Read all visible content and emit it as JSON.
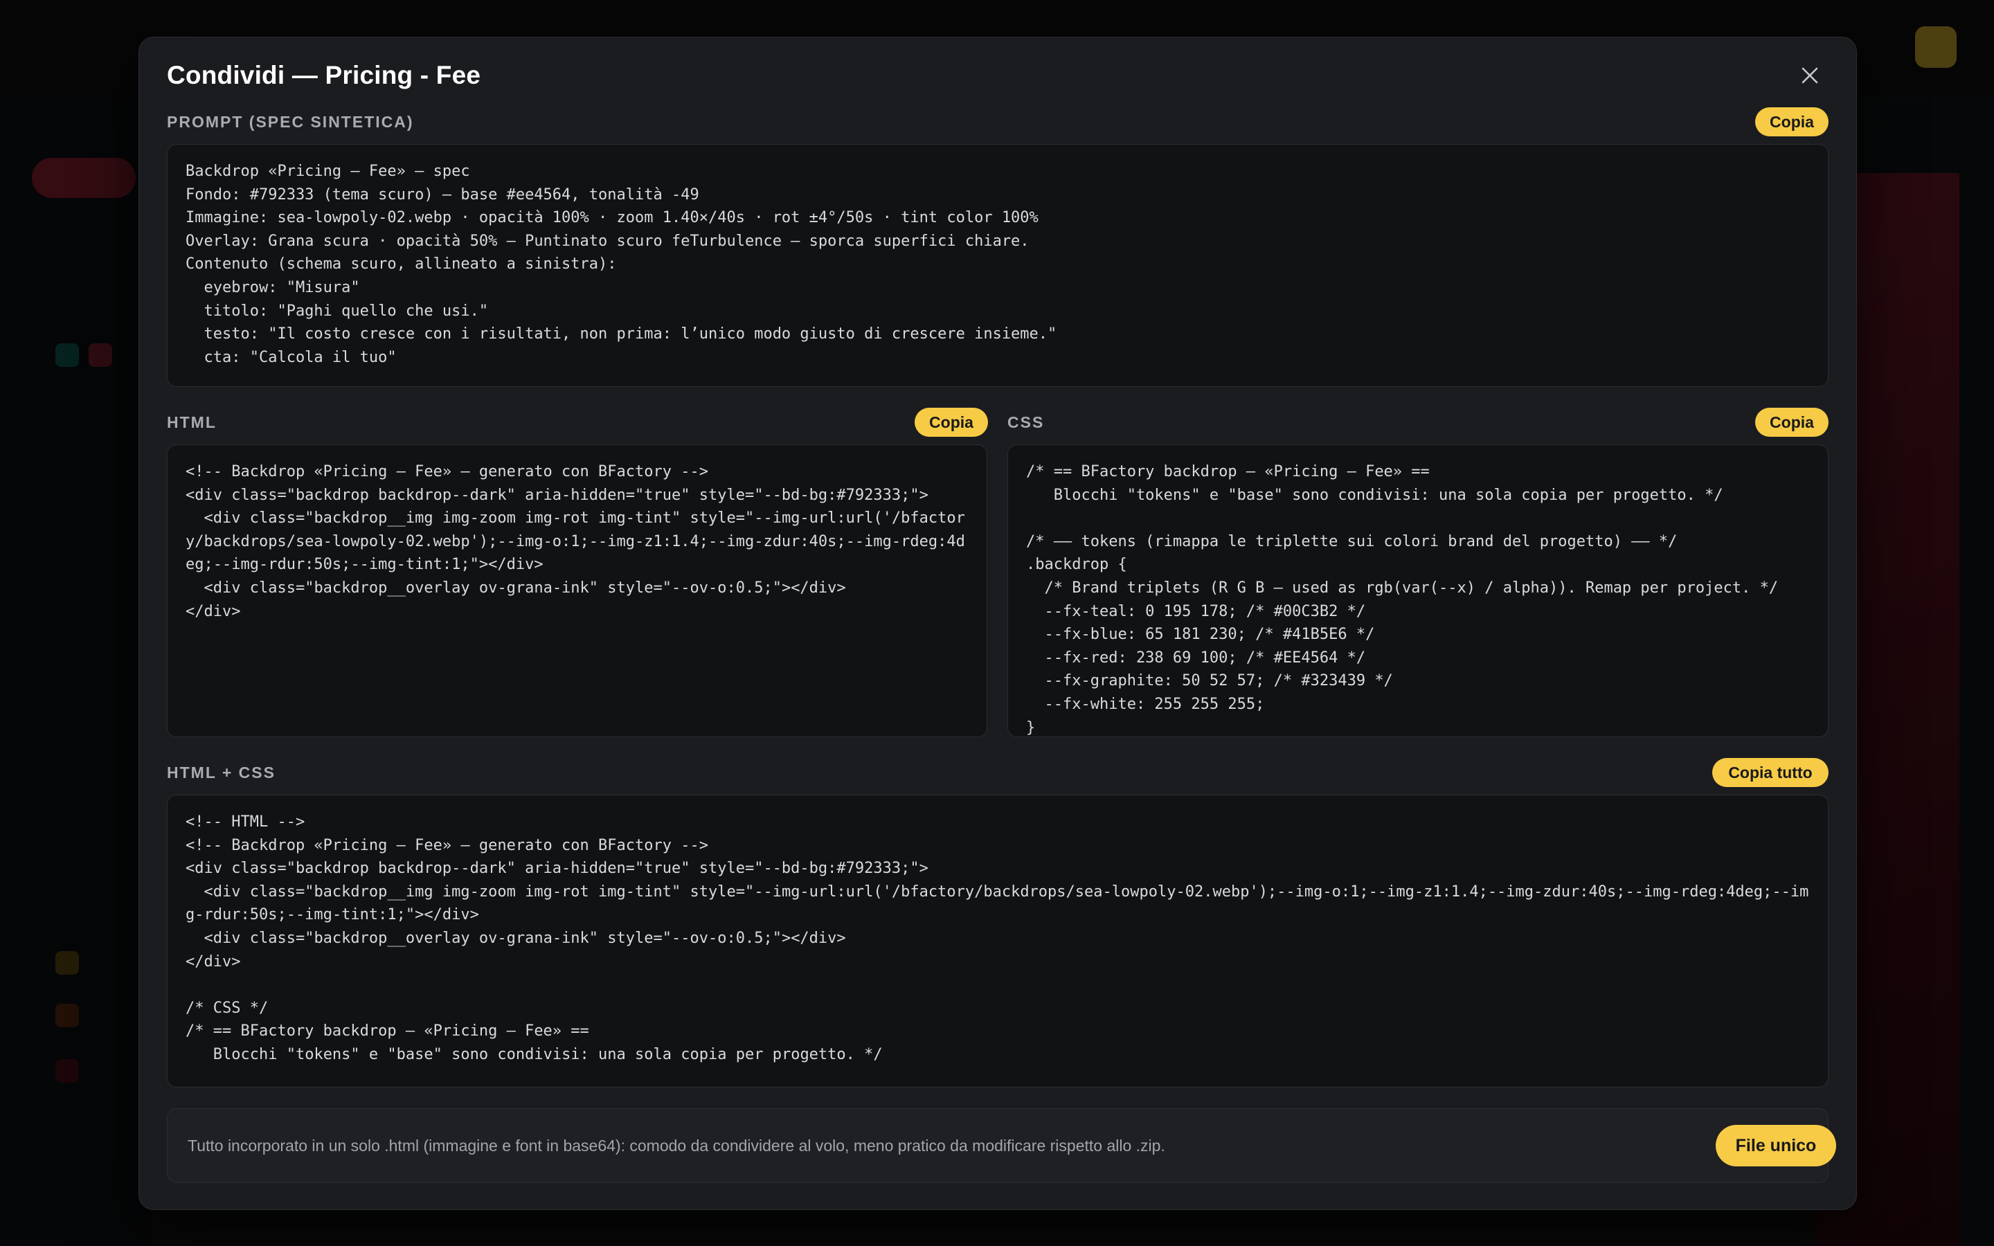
{
  "modal": {
    "title": "Condividi — Pricing - Fee",
    "close_icon": "close-icon"
  },
  "prompt_section": {
    "label": "PROMPT (SPEC SINTETICA)",
    "copy_label": "Copia",
    "content": "Backdrop «Pricing – Fee» — spec\nFondo: #792333 (tema scuro) — base #ee4564, tonalità -49\nImmagine: sea-lowpoly-02.webp · opacità 100% · zoom 1.40×/40s · rot ±4°/50s · tint color 100%\nOverlay: Grana scura · opacità 50% — Puntinato scuro feTurbulence — sporca superfici chiare.\nContenuto (schema scuro, allineato a sinistra):\n  eyebrow: \"Misura\"\n  titolo: \"Paghi quello che usi.\"\n  testo: \"Il costo cresce con i risultati, non prima: l’unico modo giusto di crescere insieme.\"\n  cta: \"Calcola il tuo\""
  },
  "html_section": {
    "label": "HTML",
    "copy_label": "Copia",
    "content": "<!-- Backdrop «Pricing – Fee» — generato con BFactory -->\n<div class=\"backdrop backdrop--dark\" aria-hidden=\"true\" style=\"--bd-bg:#792333;\">\n  <div class=\"backdrop__img img-zoom img-rot img-tint\" style=\"--img-url:url('/bfactory/backdrops/sea-lowpoly-02.webp');--img-o:1;--img-z1:1.4;--img-zdur:40s;--img-rdeg:4deg;--img-rdur:50s;--img-tint:1;\"></div>\n  <div class=\"backdrop__overlay ov-grana-ink\" style=\"--ov-o:0.5;\"></div>\n</div>"
  },
  "css_section": {
    "label": "CSS",
    "copy_label": "Copia",
    "content": "/* == BFactory backdrop — «Pricing – Fee» ==\n   Blocchi \"tokens\" e \"base\" sono condivisi: una sola copia per progetto. */\n\n/* —— tokens (rimappa le triplette sui colori brand del progetto) —— */\n.backdrop {\n  /* Brand triplets (R G B — used as rgb(var(--x) / alpha)). Remap per project. */\n  --fx-teal: 0 195 178; /* #00C3B2 */\n  --fx-blue: 65 181 230; /* #41B5E6 */\n  --fx-red: 238 69 100; /* #EE4564 */\n  --fx-graphite: 50 52 57; /* #323439 */\n  --fx-white: 255 255 255;\n}"
  },
  "combined_section": {
    "label": "HTML + CSS",
    "copy_label": "Copia tutto",
    "content": "<!-- HTML -->\n<!-- Backdrop «Pricing – Fee» — generato con BFactory -->\n<div class=\"backdrop backdrop--dark\" aria-hidden=\"true\" style=\"--bd-bg:#792333;\">\n  <div class=\"backdrop__img img-zoom img-rot img-tint\" style=\"--img-url:url('/bfactory/backdrops/sea-lowpoly-02.webp');--img-o:1;--img-z1:1.4;--img-zdur:40s;--img-rdeg:4deg;--img-rdur:50s;--img-tint:1;\"></div>\n  <div class=\"backdrop__overlay ov-grana-ink\" style=\"--ov-o:0.5;\"></div>\n</div>\n\n/* CSS */\n/* == BFactory backdrop — «Pricing – Fee» ==\n   Blocchi \"tokens\" e \"base\" sono condivisi: una sola copia per progetto. */"
  },
  "footer": {
    "text": "Tutto incorporato in un solo .html (immagine e font in base64): comodo da condividere al volo, meno pratico da modificare rispetto allo .zip.",
    "button_label": "File unico"
  },
  "colors": {
    "accent": "#f7cb46",
    "modal_bg": "#1b1c1f",
    "code_bg": "#111214"
  }
}
